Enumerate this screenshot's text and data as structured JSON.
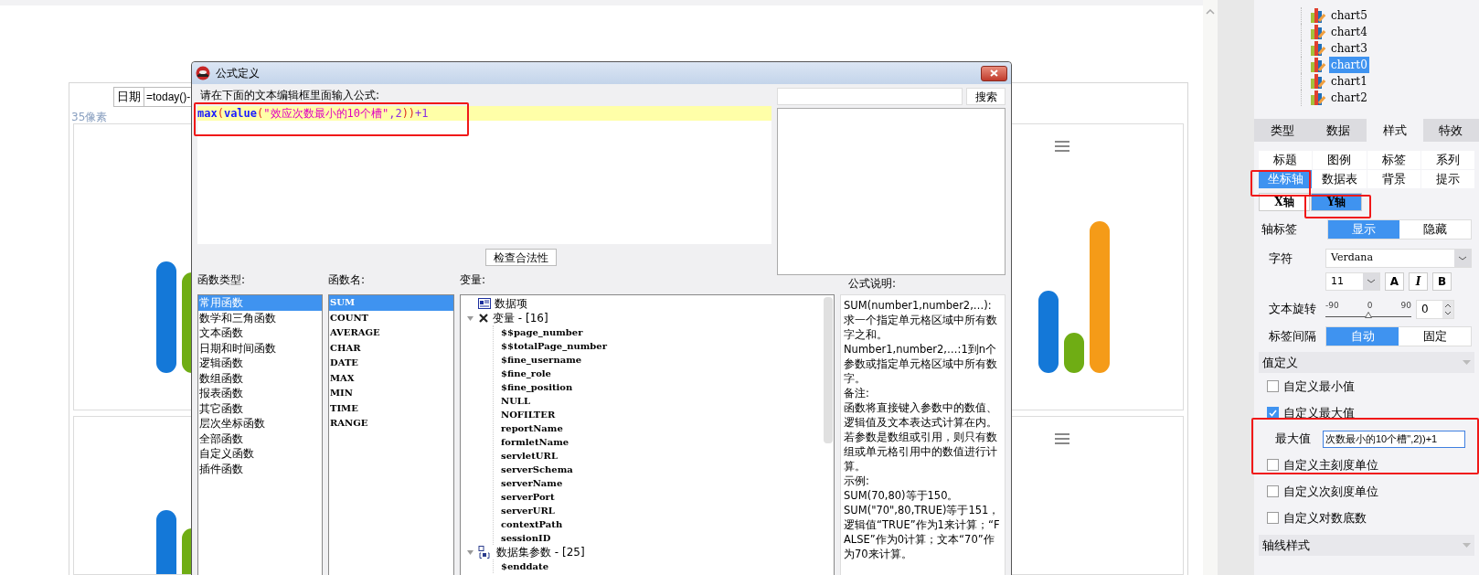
{
  "canvas": {
    "date_label": "日期",
    "date_formula": "=today()-",
    "size_note": "35像素"
  },
  "dialog": {
    "title": "公式定义",
    "prompt": "请在下面的文本编辑框里面输入公式:",
    "formula": [
      {
        "text": "max",
        "kind": "function"
      },
      {
        "text": "(",
        "kind": "paren"
      },
      {
        "text": "value",
        "kind": "function"
      },
      {
        "text": "(",
        "kind": "paren"
      },
      {
        "text": "\"效应次数最小的10个槽\"",
        "kind": "string"
      },
      {
        "text": ",2",
        "kind": "other"
      },
      {
        "text": "))",
        "kind": "paren"
      },
      {
        "text": "+1",
        "kind": "other"
      }
    ],
    "search_button": "搜索",
    "check_button": "检查合法性",
    "function_types": {
      "label": "函数类型:",
      "items": [
        {
          "text": "常用函数",
          "selected": true
        },
        {
          "text": "数学和三角函数",
          "selected": false
        },
        {
          "text": "文本函数",
          "selected": false
        },
        {
          "text": "日期和时间函数",
          "selected": false
        },
        {
          "text": "逻辑函数",
          "selected": false
        },
        {
          "text": "数组函数",
          "selected": false
        },
        {
          "text": "报表函数",
          "selected": false
        },
        {
          "text": "其它函数",
          "selected": false
        },
        {
          "text": "层次坐标函数",
          "selected": false
        },
        {
          "text": "全部函数",
          "selected": false
        },
        {
          "text": "自定义函数",
          "selected": false
        },
        {
          "text": "插件函数",
          "selected": false
        }
      ]
    },
    "function_names": {
      "label": "函数名:",
      "items": [
        {
          "text": "SUM",
          "selected": true
        },
        {
          "text": "COUNT",
          "selected": false
        },
        {
          "text": "AVERAGE",
          "selected": false
        },
        {
          "text": "CHAR",
          "selected": false
        },
        {
          "text": "DATE",
          "selected": false
        },
        {
          "text": "MAX",
          "selected": false
        },
        {
          "text": "MIN",
          "selected": false
        },
        {
          "text": "TIME",
          "selected": false
        },
        {
          "text": "RANGE",
          "selected": false
        }
      ]
    },
    "variables": {
      "label": "变量:",
      "tree": [
        {
          "text": "数据项",
          "kind": "dataitem"
        },
        {
          "text": "变量 - [16]",
          "kind": "variable",
          "expanded": true,
          "children": [
            {
              "text": "$$page_number"
            },
            {
              "text": "$$totalPage_number"
            },
            {
              "text": "$fine_username"
            },
            {
              "text": "$fine_role"
            },
            {
              "text": "$fine_position"
            },
            {
              "text": "NULL"
            },
            {
              "text": "NOFILTER"
            },
            {
              "text": "reportName"
            },
            {
              "text": "formletName"
            },
            {
              "text": "servletURL"
            },
            {
              "text": "serverSchema"
            },
            {
              "text": "serverName"
            },
            {
              "text": "serverPort"
            },
            {
              "text": "serverURL"
            },
            {
              "text": "contextPath"
            },
            {
              "text": "sessionID"
            }
          ]
        },
        {
          "text": "数据集参数 - [25]",
          "kind": "dataset",
          "expanded": true,
          "children": [
            {
              "text": "$enddate"
            }
          ]
        }
      ]
    },
    "description": {
      "label": "公式说明:",
      "paragraphs": [
        "SUM(number1,number2,…):求一个指定单元格区域中所有数字之和。",
        "Number1,number2,…:1到n个参数或指定单元格区域中所有数字。",
        "备注:",
        "函数将直接键入参数中的数值、逻辑值及文本表达式计算在内。若参数是数组或引用，则只有数组或单元格引用中的数值进行计算。",
        "示例:",
        "SUM(70,80)等于150。",
        "SUM(\"70\",80,TRUE)等于151，逻辑值“TRUE”作为1来计算；“FALSE”作为0计算；文本“70”作为70来计算。"
      ]
    }
  },
  "right_panel": {
    "charts": [
      {
        "text": "chart5",
        "selected": false
      },
      {
        "text": "chart4",
        "selected": false
      },
      {
        "text": "chart3",
        "selected": false
      },
      {
        "text": "chart0",
        "selected": true
      },
      {
        "text": "chart1",
        "selected": false
      },
      {
        "text": "chart2",
        "selected": false
      }
    ],
    "main_tabs": [
      {
        "text": "类型",
        "selected": false
      },
      {
        "text": "数据",
        "selected": false
      },
      {
        "text": "样式",
        "selected": true
      },
      {
        "text": "特效",
        "selected": false
      }
    ],
    "style_tabs": [
      {
        "text": "标题",
        "selected": false
      },
      {
        "text": "图例",
        "selected": false
      },
      {
        "text": "标签",
        "selected": false
      },
      {
        "text": "系列",
        "selected": false
      },
      {
        "text": "坐标轴",
        "selected": true
      },
      {
        "text": "数据表",
        "selected": false
      },
      {
        "text": "背景",
        "selected": false
      },
      {
        "text": "提示",
        "selected": false
      }
    ],
    "axis_tabs": [
      {
        "text": "X轴",
        "selected": false
      },
      {
        "text": "Y轴",
        "selected": true
      }
    ],
    "axis_label": {
      "label": "轴标签",
      "options": [
        {
          "text": "显示",
          "selected": true
        },
        {
          "text": "隐藏",
          "selected": false
        }
      ]
    },
    "font": {
      "label": "字符",
      "value": "Verdana",
      "size": "11",
      "styles": [
        "A",
        "I",
        "B"
      ]
    },
    "rotation": {
      "label": "文本旋转",
      "ticks": [
        "-90",
        "0",
        "90"
      ],
      "level": 0.5,
      "value": "0"
    },
    "interval": {
      "label": "标签间隔",
      "options": [
        {
          "text": "自动",
          "selected": true
        },
        {
          "text": "固定",
          "selected": false
        }
      ]
    },
    "value_section": {
      "title": "值定义",
      "items": [
        {
          "label": "自定义最小值",
          "checked": false
        },
        {
          "label": "自定义最大值",
          "checked": true,
          "field_label": "最大值",
          "field_value": "次数最小的10个槽\",2))+1"
        },
        {
          "label": "自定义主刻度单位",
          "checked": false
        },
        {
          "label": "自定义次刻度单位",
          "checked": false
        },
        {
          "label": "自定义对数底数",
          "checked": false
        }
      ]
    },
    "axis_style_section": {
      "title": "轴线样式"
    }
  }
}
